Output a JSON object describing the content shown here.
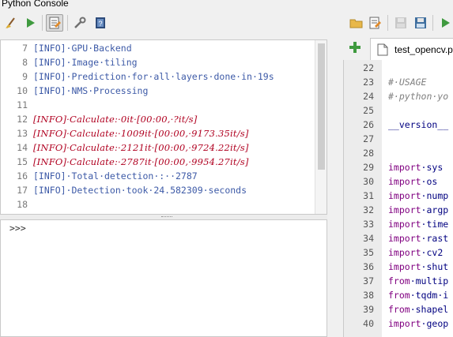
{
  "app": {
    "title": "Python Console"
  },
  "toolbar": {
    "left_icons": [
      "clear-console-icon",
      "run-command-icon",
      "show-editor-icon",
      "options-icon",
      "help-icon"
    ],
    "right_icons": [
      "open-script-icon",
      "open-in-external-editor-icon",
      "save-icon",
      "save-as-icon",
      "run-script-icon"
    ]
  },
  "console_output": {
    "lines": [
      {
        "n": "7",
        "text": "[INFO]·GPU·Backend",
        "style": "info"
      },
      {
        "n": "8",
        "text": "[INFO]·Image·tiling",
        "style": "info"
      },
      {
        "n": "9",
        "text": "[INFO]·Prediction·for·all·layers·done·in·19s",
        "style": "info"
      },
      {
        "n": "10",
        "text": "[INFO]·NMS·Processing",
        "style": "info"
      },
      {
        "n": "11",
        "text": "",
        "style": "info"
      },
      {
        "n": "12",
        "text": "[INFO]·Calculate:·0it·[00:00,·?it/s]",
        "style": "err"
      },
      {
        "n": "13",
        "text": "[INFO]·Calculate:·1009it·[00:00,·9173.35it/s]",
        "style": "err"
      },
      {
        "n": "14",
        "text": "[INFO]·Calculate:·2121it·[00:00,·9724.22it/s]",
        "style": "err"
      },
      {
        "n": "15",
        "text": "[INFO]·Calculate:·2787it·[00:00,·9954.27it/s]",
        "style": "err"
      },
      {
        "n": "16",
        "text": "[INFO]·Total·detection·:··2787",
        "style": "info"
      },
      {
        "n": "17",
        "text": "[INFO]·Detection·took·24.582309·seconds",
        "style": "info"
      },
      {
        "n": "18",
        "text": "",
        "style": "info"
      }
    ]
  },
  "console_input": {
    "prompt": ">>>",
    "value": ""
  },
  "editor": {
    "tab_label": "test_opencv.py",
    "lines": [
      {
        "n": "22",
        "kind": "blank",
        "a": "",
        "b": ""
      },
      {
        "n": "23",
        "kind": "comment",
        "a": "#·USAGE",
        "b": ""
      },
      {
        "n": "24",
        "kind": "comment",
        "a": "#·python·yo",
        "b": ""
      },
      {
        "n": "25",
        "kind": "blank",
        "a": "",
        "b": ""
      },
      {
        "n": "26",
        "kind": "dunder",
        "a": "__version__",
        "b": ""
      },
      {
        "n": "27",
        "kind": "blank",
        "a": "",
        "b": ""
      },
      {
        "n": "28",
        "kind": "blank",
        "a": "",
        "b": ""
      },
      {
        "n": "29",
        "kind": "code",
        "a": "import",
        "b": "·sys"
      },
      {
        "n": "30",
        "kind": "code",
        "a": "import",
        "b": "·os"
      },
      {
        "n": "31",
        "kind": "code",
        "a": "import",
        "b": "·nump"
      },
      {
        "n": "32",
        "kind": "code",
        "a": "import",
        "b": "·argp"
      },
      {
        "n": "33",
        "kind": "code",
        "a": "import",
        "b": "·time"
      },
      {
        "n": "34",
        "kind": "code",
        "a": "import",
        "b": "·rast"
      },
      {
        "n": "35",
        "kind": "code",
        "a": "import",
        "b": "·cv2"
      },
      {
        "n": "36",
        "kind": "code",
        "a": "import",
        "b": "·shut"
      },
      {
        "n": "37",
        "kind": "code",
        "a": "from",
        "b": "·multip"
      },
      {
        "n": "38",
        "kind": "code",
        "a": "from",
        "b": "·tqdm·i"
      },
      {
        "n": "39",
        "kind": "code",
        "a": "from",
        "b": "·shapel"
      },
      {
        "n": "40",
        "kind": "code",
        "a": "import",
        "b": "·geop"
      }
    ]
  }
}
